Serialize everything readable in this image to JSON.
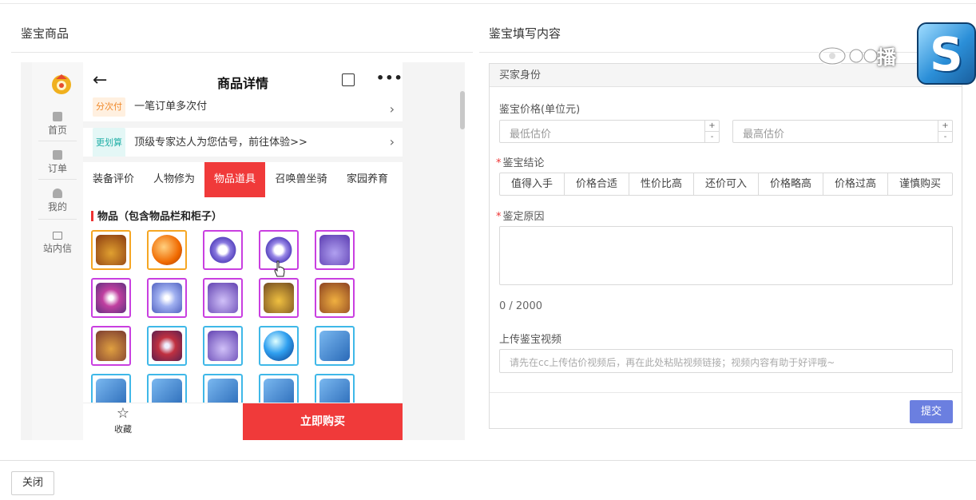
{
  "left_section": {
    "title": "鉴宝商品"
  },
  "right_section": {
    "title": "鉴宝填写内容"
  },
  "sidenav": {
    "items": [
      {
        "label": "首页"
      },
      {
        "label": "订单"
      },
      {
        "label": "我的"
      },
      {
        "label": "站内信"
      }
    ]
  },
  "phone": {
    "title": "商品详情",
    "back": "←",
    "more": "•••",
    "rows": [
      {
        "badge": "分次付",
        "text": "一笔订单多次付"
      },
      {
        "badge": "更划算",
        "text": "顶级专家达人为您估号，前往体验>>"
      }
    ],
    "tabs": [
      {
        "label": "装备评价"
      },
      {
        "label": "人物修为"
      },
      {
        "label": "物品道具"
      },
      {
        "label": "召唤兽坐骑"
      },
      {
        "label": "家园养育"
      }
    ],
    "active_tab": "物品道具",
    "category_title": "物品（包含物品栏和柜子）",
    "footer": {
      "fav_label": "收藏",
      "buy_label": "立即购买"
    }
  },
  "form": {
    "header": "买家身份",
    "price_label": "鉴宝价格(单位元)",
    "min_placeholder": "最低估价",
    "max_placeholder": "最高估价",
    "conclusion_label": "鉴宝结论",
    "conclusion_options": [
      "值得入手",
      "价格合适",
      "性价比高",
      "还价可入",
      "价格略高",
      "价格过高",
      "谨慎购买"
    ],
    "reason_label": "鉴定原因",
    "counter": "0 / 2000",
    "video_label": "上传鉴宝视频",
    "video_placeholder": "请先在cc上传估价视频后，再在此处粘贴视频链接；视频内容有助于好评哦~",
    "submit_label": "提交",
    "required_mark": "*"
  },
  "watermark": {
    "text": "播"
  },
  "close_label": "关闭",
  "colors": {
    "accent_red": "#f03a3a",
    "submit_blue": "#6b7fe0",
    "badge_orange": "#f08a2c",
    "badge_teal": "#24b0a8"
  }
}
